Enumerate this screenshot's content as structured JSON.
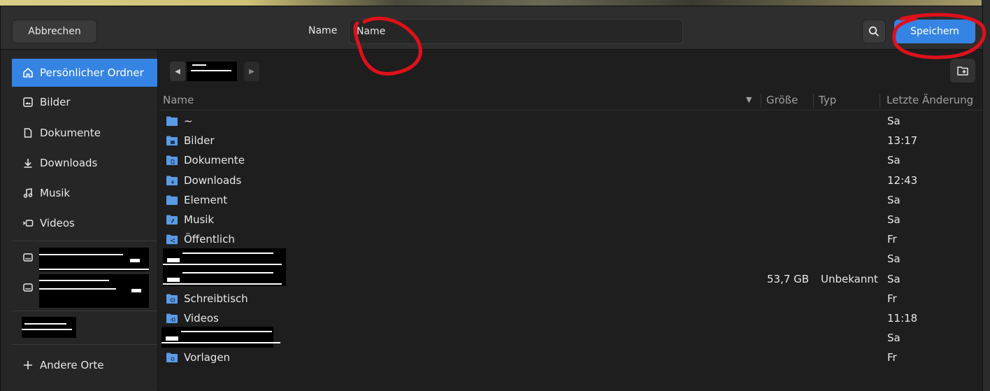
{
  "header": {
    "cancel_label": "Abbrechen",
    "name_label": "Name",
    "name_value": "Name",
    "save_label": "Speichern",
    "search_icon": "search-icon"
  },
  "colors": {
    "accent": "#3584e4",
    "folder": "#5b9be6",
    "annotation": "#e0101a"
  },
  "sidebar": {
    "items": [
      {
        "label": "Persönlicher Ordner",
        "icon": "home-icon",
        "active": true
      },
      {
        "label": "Bilder",
        "icon": "image-icon"
      },
      {
        "label": "Dokumente",
        "icon": "document-icon"
      },
      {
        "label": "Downloads",
        "icon": "download-icon"
      },
      {
        "label": "Musik",
        "icon": "music-icon"
      },
      {
        "label": "Videos",
        "icon": "video-icon"
      }
    ],
    "other_places": "Andere Orte"
  },
  "columns": {
    "name": "Name",
    "size": "Größe",
    "type": "Typ",
    "modified": "Letzte Änderung"
  },
  "files": [
    {
      "name": "~",
      "date": "Sa"
    },
    {
      "name": "Bilder",
      "date": "13:17",
      "emblem": "image"
    },
    {
      "name": "Dokumente",
      "date": "Sa",
      "emblem": "doc"
    },
    {
      "name": "Downloads",
      "date": "12:43",
      "emblem": "down"
    },
    {
      "name": "Element",
      "date": "Sa"
    },
    {
      "name": "Musik",
      "date": "Sa",
      "emblem": "music"
    },
    {
      "name": "Öffentlich",
      "date": "Fr",
      "emblem": "share"
    },
    {
      "name": "",
      "date": "Sa",
      "redacted": true
    },
    {
      "name": "",
      "date": "Sa",
      "size": "53,7 GB",
      "type": "Unbekannt",
      "redacted": true
    },
    {
      "name": "Schreibtisch",
      "date": "Fr",
      "emblem": "desk"
    },
    {
      "name": "Videos",
      "date": "11:18",
      "emblem": "video"
    },
    {
      "name": "",
      "date": "Sa",
      "redacted": true
    },
    {
      "name": "Vorlagen",
      "date": "Fr",
      "emblem": "tmpl"
    }
  ]
}
